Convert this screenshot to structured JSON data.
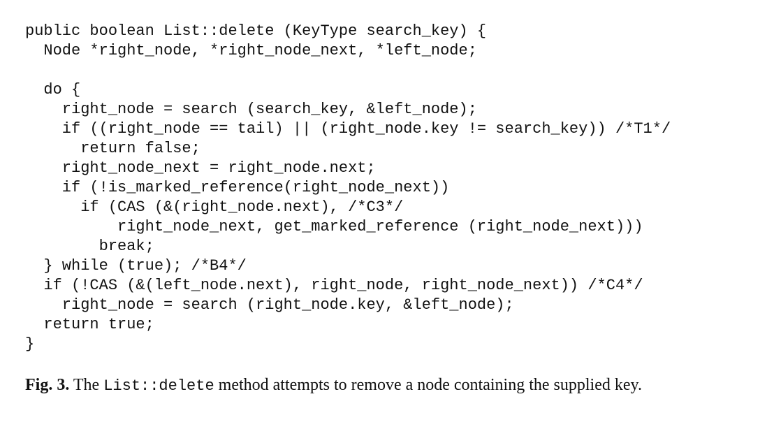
{
  "code": {
    "lines": [
      "public boolean List::delete (KeyType search_key) {",
      "  Node *right_node, *right_node_next, *left_node;",
      "",
      "  do {",
      "    right_node = search (search_key, &left_node);",
      "    if ((right_node == tail) || (right_node.key != search_key)) /*T1*/",
      "      return false;",
      "    right_node_next = right_node.next;",
      "    if (!is_marked_reference(right_node_next))",
      "      if (CAS (&(right_node.next), /*C3*/",
      "          right_node_next, get_marked_reference (right_node_next)))",
      "        break;",
      "  } while (true); /*B4*/",
      "  if (!CAS (&(left_node.next), right_node, right_node_next)) /*C4*/",
      "    right_node = search (right_node.key, &left_node);",
      "  return true;",
      "}"
    ]
  },
  "caption": {
    "label": "Fig. 3.",
    "text_before": " The ",
    "code_term": "List::delete",
    "text_after": " method attempts to remove a node containing the supplied key."
  }
}
